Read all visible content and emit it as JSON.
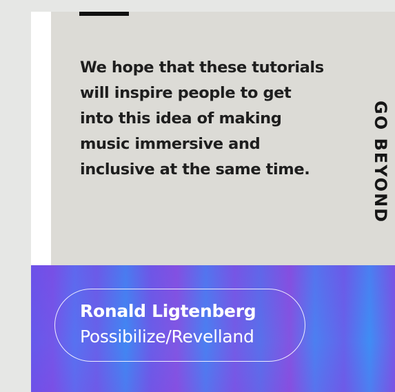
{
  "quote": {
    "lines": [
      "We hope that these tutorials",
      "will inspire people to get",
      "into this idea of making",
      "music immersive and",
      "inclusive at the same time."
    ]
  },
  "side_label": "GO BEYOND",
  "author": {
    "name": "Ronald Ligtenberg",
    "organization": "Possibilize/Revelland"
  },
  "colors": {
    "card_background": "#dcdbd6",
    "page_background": "#e6e7e5",
    "band_primary": "#6a52e9",
    "band_secondary": "#3f88f2"
  }
}
